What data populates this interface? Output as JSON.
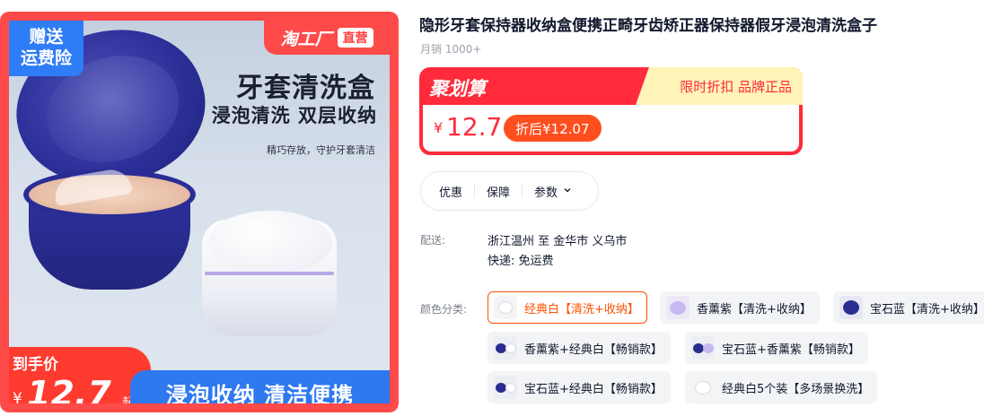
{
  "hero": {
    "badge_line1": "赠送",
    "badge_line2": "运费险",
    "brand_name": "淘工厂",
    "brand_direct": "直营",
    "title": "牙套清洗盒",
    "subtitle": "浸泡清洗 双层收纳",
    "small_text": "精巧存放，守护牙套清洁",
    "price_label": "到手价",
    "price_currency": "¥",
    "price_value": "12.7",
    "price_suffix": "起",
    "band_text": "浸泡收纳 清洁便携"
  },
  "product": {
    "title": "隐形牙套保持器收纳盒便携正畸牙齿矫正器保持器假牙浸泡清洗盒子",
    "sales": "月销 1000+"
  },
  "promo": {
    "name": "聚划算",
    "right_text": "限时折扣 品牌正品",
    "currency": "¥",
    "price": "12.7",
    "after_discount": "折后¥12.07",
    "colors": {
      "accent": "#ff2a3c",
      "banner": "#fff3b8",
      "pill": "#ff4f1f"
    }
  },
  "tabs": [
    {
      "label": "优惠"
    },
    {
      "label": "保障"
    },
    {
      "label": "参数"
    }
  ],
  "shipping": {
    "label": "配送:",
    "route": "浙江温州 至 金华市 义乌市",
    "fee": "快递: 免运费"
  },
  "sku": {
    "label": "颜色分类:",
    "selected_color": "#ff5000",
    "options": [
      {
        "label": "经典白【清洗+收纳】",
        "selected": true
      },
      {
        "label": "香薰紫【清洗+收纳】",
        "selected": false
      },
      {
        "label": "宝石蓝【清洗+收纳】",
        "selected": false
      },
      {
        "label": "香薰紫+经典白【畅销款】",
        "selected": false
      },
      {
        "label": "宝石蓝+香薰紫【畅销款】",
        "selected": false
      },
      {
        "label": "宝石蓝+经典白【畅销款】",
        "selected": false
      },
      {
        "label": "经典白5个装【多场景换洗】",
        "selected": false
      }
    ]
  }
}
